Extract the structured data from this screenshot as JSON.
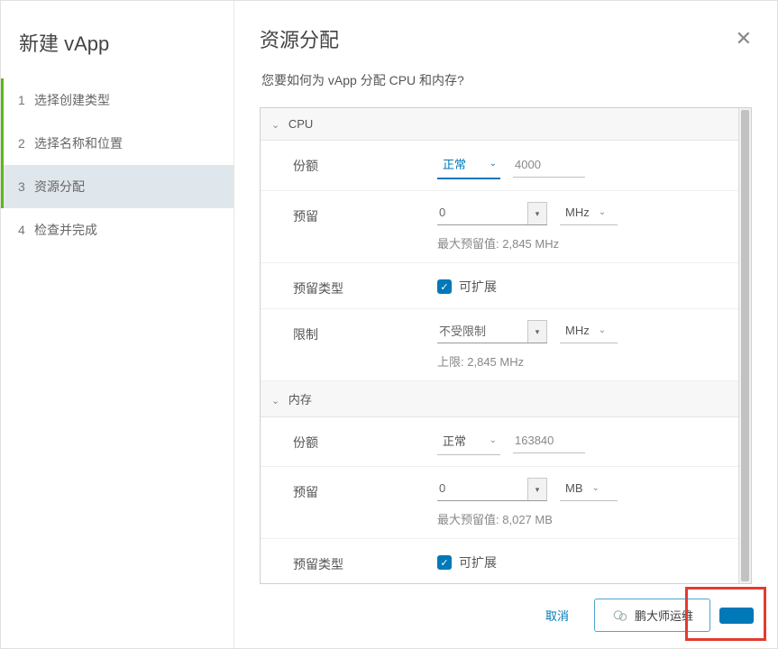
{
  "wizard": {
    "title": "新建 vApp",
    "steps": [
      {
        "num": "1",
        "label": "选择创建类型",
        "state": "completed"
      },
      {
        "num": "2",
        "label": "选择名称和位置",
        "state": "completed"
      },
      {
        "num": "3",
        "label": "资源分配",
        "state": "active"
      },
      {
        "num": "4",
        "label": "检查并完成",
        "state": "pending"
      }
    ]
  },
  "page": {
    "title": "资源分配",
    "prompt": "您要如何为 vApp 分配 CPU 和内存?"
  },
  "sections": {
    "cpu": {
      "header": "CPU",
      "share": {
        "label": "份额",
        "level": "正常",
        "value": "4000"
      },
      "reserve": {
        "label": "预留",
        "value": "0",
        "unit": "MHz",
        "hint_prefix": "最大预留值:",
        "hint_value": "2,845 MHz"
      },
      "reserveType": {
        "label": "预留类型",
        "checkbox_label": "可扩展",
        "checked": true
      },
      "limit": {
        "label": "限制",
        "value": "不受限制",
        "unit": "MHz",
        "hint_prefix": "上限:",
        "hint_value": "2,845 MHz"
      }
    },
    "memory": {
      "header": "内存",
      "share": {
        "label": "份额",
        "level": "正常",
        "value": "163840"
      },
      "reserve": {
        "label": "预留",
        "value": "0",
        "unit": "MB",
        "hint_prefix": "最大预留值:",
        "hint_value": "8,027 MB"
      },
      "reserveType": {
        "label": "预留类型",
        "checkbox_label": "可扩展",
        "checked": true
      }
    }
  },
  "footer": {
    "cancel": "取消",
    "back_text": "鹏大师运维",
    "next": ""
  }
}
